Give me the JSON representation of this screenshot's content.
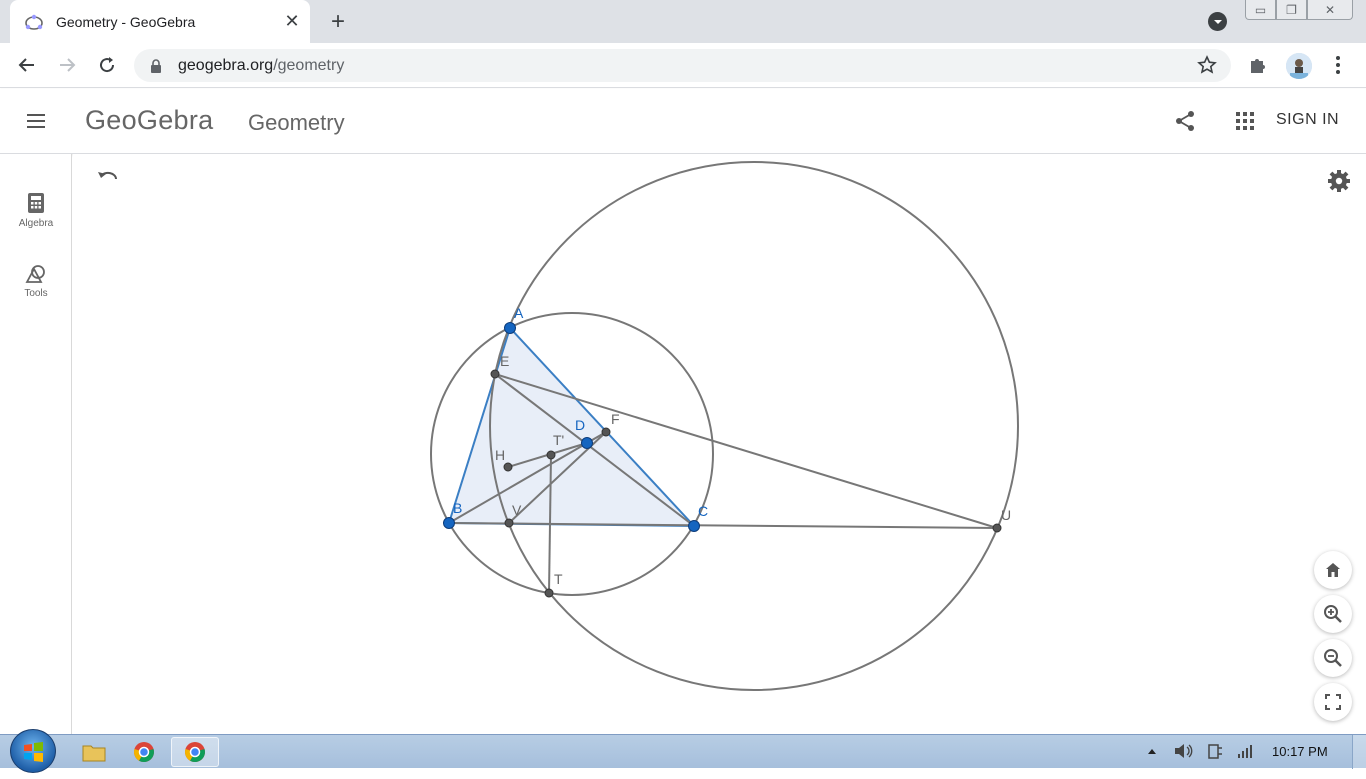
{
  "browser": {
    "tab_title": "Geometry - GeoGebra",
    "url_host": "geogebra.org",
    "url_path": "/geometry"
  },
  "header": {
    "logo": "GeoGebra",
    "app_name": "Geometry",
    "signin_label": "SIGN IN"
  },
  "sidebar": {
    "items": [
      {
        "label": "Algebra",
        "icon": "calculator-icon"
      },
      {
        "label": "Tools",
        "icon": "shapes-icon"
      }
    ]
  },
  "construction": {
    "points": {
      "A": "A",
      "B": "B",
      "C": "C",
      "D": "D",
      "E": "E",
      "F": "F",
      "H": "H",
      "T": "T",
      "T_prime": "T'",
      "U": "U",
      "V": "V"
    },
    "colors": {
      "free_point": "#1565c0",
      "dependent_point": "#555555",
      "triangle_fill": "#e8eef8",
      "triangle_stroke": "#3b7fc4",
      "line": "#777777"
    }
  },
  "taskbar": {
    "clock": "10:17 PM"
  }
}
